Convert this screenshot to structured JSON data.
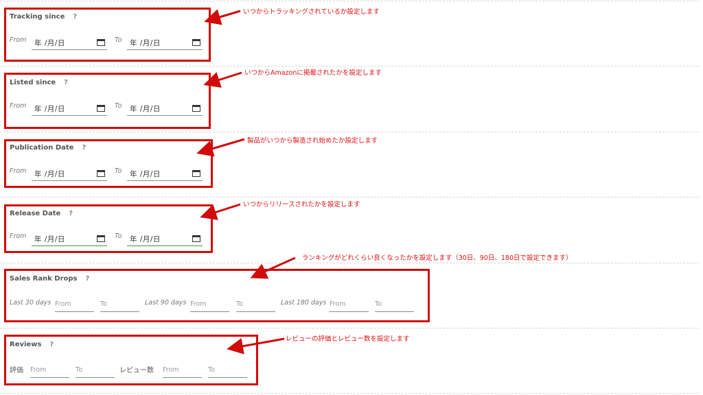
{
  "date_placeholder": "年 /月/日",
  "sections": {
    "tracking": {
      "title": "Tracking since",
      "help": "?",
      "from_label": "From",
      "to_label": "To"
    },
    "listed": {
      "title": "Listed since",
      "help": "?",
      "from_label": "From",
      "to_label": "To"
    },
    "publication": {
      "title": "Publication Date",
      "help": "?",
      "from_label": "From",
      "to_label": "To"
    },
    "release": {
      "title": "Release Date",
      "help": "?",
      "from_label": "From",
      "to_label": "To"
    },
    "sales_rank": {
      "title": "Sales Rank Drops",
      "help": "?",
      "groups": [
        {
          "label": "Last 30 days",
          "from_ph": "From",
          "to_ph": "To"
        },
        {
          "label": "Last 90 days",
          "from_ph": "From",
          "to_ph": "To"
        },
        {
          "label": "Last 180 days",
          "from_ph": "From",
          "to_ph": "To"
        }
      ]
    },
    "reviews": {
      "title": "Reviews",
      "help": "?",
      "groups": [
        {
          "label": "評価",
          "from_ph": "From",
          "to_ph": "To"
        },
        {
          "label": "レビュー数",
          "from_ph": "From",
          "to_ph": "To"
        }
      ]
    }
  },
  "annotations": {
    "tracking": "いつからトラッキングされているか設定します",
    "listed": "いつからAmazonに掲載されたかを設定します",
    "publication": "製品がいつから製造され始めたか設定します",
    "release": "いつからリリースされたかを設定します",
    "sales_rank": "ランキングがどれくらい良くなったかを設定します（30日、90日、180日で設定できます）",
    "reviews": "レビューの評価とレビュー数を設定します"
  },
  "colors": {
    "annotation_red": "#d10a0a",
    "release_underline": "#3a9a3a"
  }
}
